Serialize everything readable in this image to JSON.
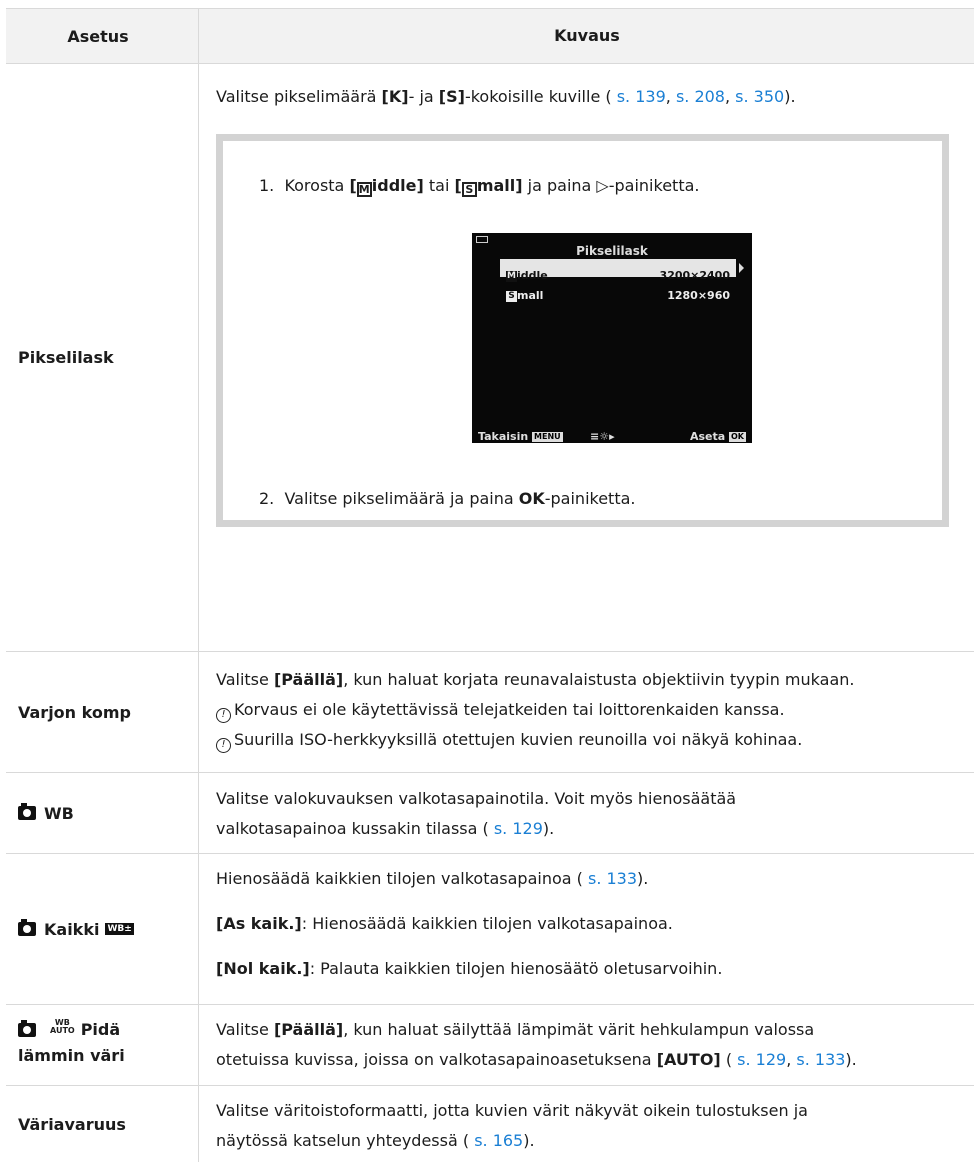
{
  "header": {
    "col1": "Asetus",
    "col2": "Kuvaus"
  },
  "rows": {
    "pikselilask": {
      "label": "Pikselilask",
      "desc_pre": "Valitse pikselimäärä ",
      "desc_k": "[K]",
      "desc_mid": "- ja ",
      "desc_s": "[S]",
      "desc_post": "-kokoisille kuville (",
      "links": [
        "s. 139",
        "s. 208",
        "s. 350"
      ],
      "step1_num": "1.",
      "step1_a": "Korosta ",
      "step1_middle": "iddle]",
      "step1_tai": " tai ",
      "step1_small": "mall]",
      "step1_b": " ja paina ",
      "step1_c": "-painiketta.",
      "step2_num": "2.",
      "step2_a": "Valitse pikselimäärä ja paina ",
      "step2_ok": "OK",
      "step2_b": "-painiketta.",
      "screen": {
        "title": "Pikselilask",
        "rows": [
          {
            "label": "iddle",
            "value": "3200×2400"
          },
          {
            "label": "mall",
            "value": "1280×960"
          }
        ],
        "back": "Takaisin",
        "back_icon": "MENU",
        "set": "Aseta",
        "set_icon": "OK"
      }
    },
    "varjon": {
      "label": "Varjon komp",
      "line1_pre": "Valitse ",
      "line1_b": "[Päällä]",
      "line1_post": ", kun haluat korjata reunavalaistusta objektiivin tyypin mukaan.",
      "note1": "Korvaus ei ole käytettävissä telejatkeiden tai loittorenkaiden kanssa.",
      "note2": "Suurilla ISO-herkkyyksillä otettujen kuvien reunoilla voi näkyä kohinaa."
    },
    "wb": {
      "label": "WB",
      "text1": "Valitse valokuvauksen valkotasapainotila. Voit myös hienosäätää",
      "text2": "valkotasapainoa kussakin tilassa (",
      "link": "s. 129",
      "text3": ")."
    },
    "kaikki": {
      "label": "Kaikki",
      "icon": "WB±",
      "p1": "Hienosäädä kaikkien tilojen valkotasapainoa (",
      "p1_link": "s. 133",
      "p1_end": ").",
      "p2_b": "[As kaik.]",
      "p2": ": Hienosäädä kaikkien tilojen valkotasapainoa.",
      "p3_b": "[Nol kaik.]",
      "p3": ": Palauta kaikkien tilojen hienosäätö oletusarvoihin."
    },
    "pida": {
      "label1": "Pidä",
      "label2": "lämmin väri",
      "wb_top": "WB",
      "wb_bottom": "AUTO",
      "line1_pre": "Valitse ",
      "line1_b": "[Päällä]",
      "line1_post": ", kun haluat säilyttää lämpimät värit hehkulampun valossa",
      "line2_pre": "otetuissa kuvissa, joissa on valkotasapainoasetuksena ",
      "line2_b": "[AUTO]",
      "links": [
        "s. 129",
        "s. 133"
      ]
    },
    "variavaruus": {
      "label": "Väriavaruus",
      "line1": "Valitse väritoistoformaatti, jotta kuvien värit näkyvät oikein tulostuksen ja",
      "line2": "näytössä katselun yhteydessä (",
      "link": "s. 165",
      "end": ")."
    }
  },
  "colors": {
    "link": "#1a7fd4",
    "border": "#d9d9d9",
    "header_bg": "#f2f2f2"
  }
}
